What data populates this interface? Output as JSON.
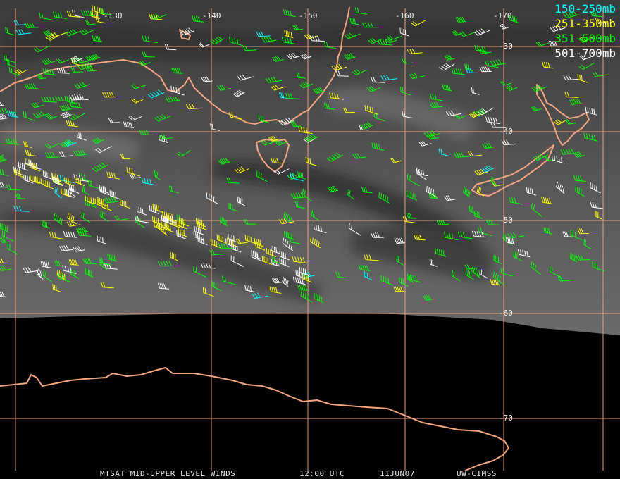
{
  "map": {
    "longitude_labels": [
      "-130",
      "-140",
      "-150",
      "-160",
      "-170"
    ],
    "latitude_labels": [
      "-30",
      "-40",
      "-50",
      "-60",
      "-70"
    ],
    "colors": {
      "grid": "#f0a27e",
      "coast": "#f4a582",
      "space": "#000000"
    }
  },
  "legend": [
    {
      "label": "150-250mb",
      "color": "#00ffff"
    },
    {
      "label": "251-350mb",
      "color": "#ffff00"
    },
    {
      "label": "351-500mb",
      "color": "#00ff00"
    },
    {
      "label": "501-700mb",
      "color": "#ffffff"
    }
  ],
  "footer": {
    "product": "MTSAT MID-UPPER LEVEL WINDS",
    "time": "12:00 UTC",
    "date": "11JUN07",
    "source": "UW-CIMSS"
  }
}
